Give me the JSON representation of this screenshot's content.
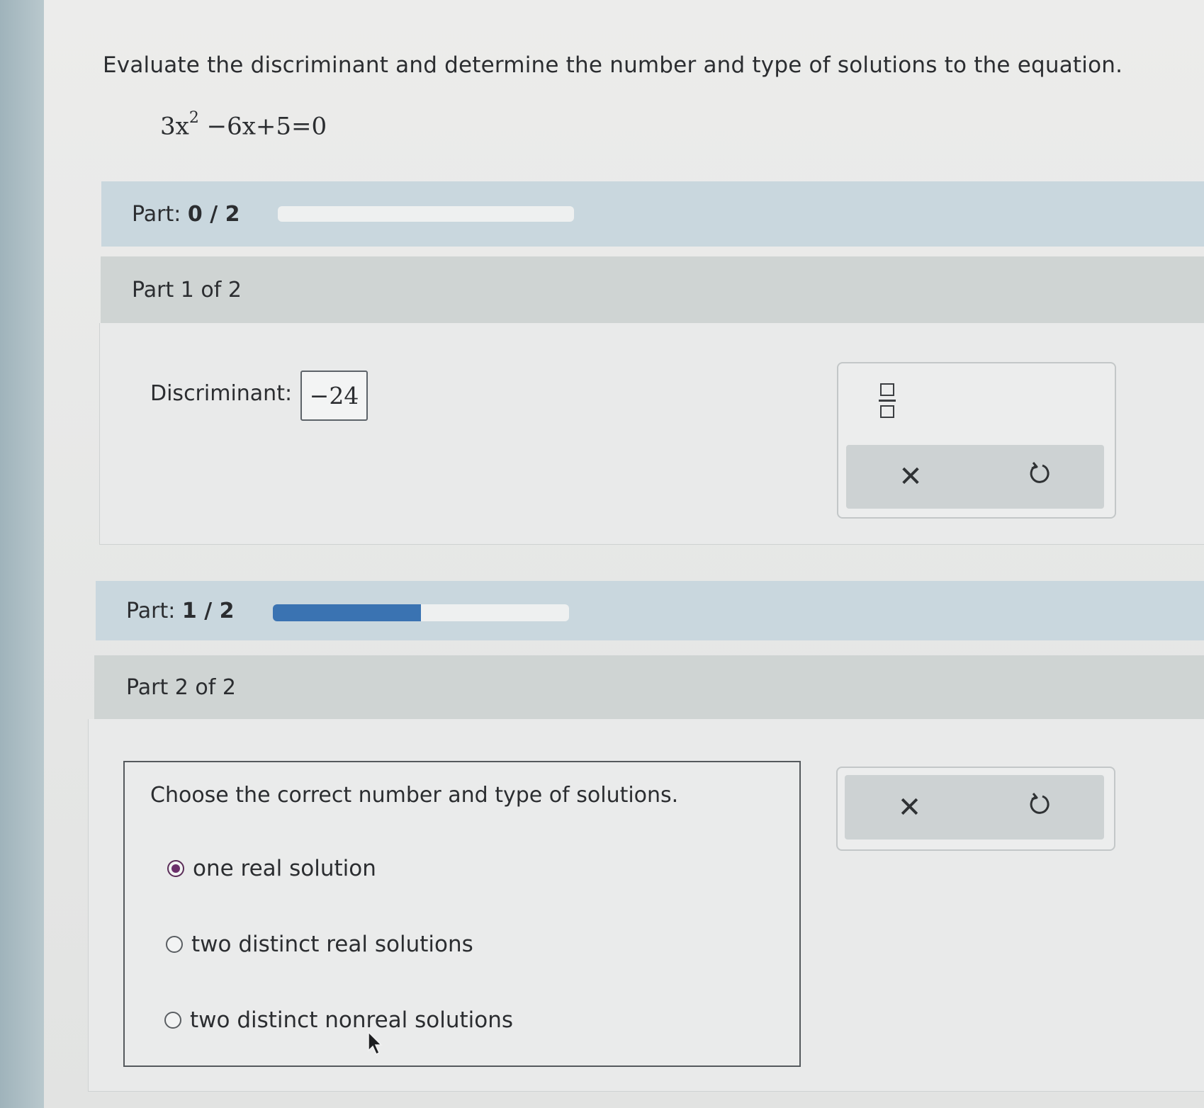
{
  "question": {
    "prompt": "Evaluate the discriminant and determine the number and type of solutions to the equation.",
    "equation_parts": [
      "3x",
      "2",
      " −6x+5=0"
    ]
  },
  "progress_1": {
    "label_prefix": "Part: ",
    "value_text": "0 / 2",
    "fraction": 0.0
  },
  "part1": {
    "header": "Part 1 of 2",
    "discriminant_label": "Discriminant:",
    "discriminant_value": "−24",
    "tools": {
      "fraction_icon": "fraction-template-icon",
      "clear_icon": "close-icon",
      "undo_icon": "undo-icon"
    }
  },
  "progress_2": {
    "label_prefix": "Part: ",
    "value_text": "1 / 2",
    "fraction": 0.5
  },
  "part2": {
    "header": "Part 2 of 2",
    "prompt": "Choose the correct number and type of solutions.",
    "options": [
      {
        "label": "one real solution",
        "selected": true
      },
      {
        "label": "two distinct real solutions",
        "selected": false
      },
      {
        "label": "two distinct nonreal solutions",
        "selected": false
      }
    ],
    "tools": {
      "clear_icon": "close-icon",
      "undo_icon": "undo-icon"
    }
  },
  "colors": {
    "progress_fill": "#3a73b2",
    "selected_radio": "#6b2f6a"
  }
}
